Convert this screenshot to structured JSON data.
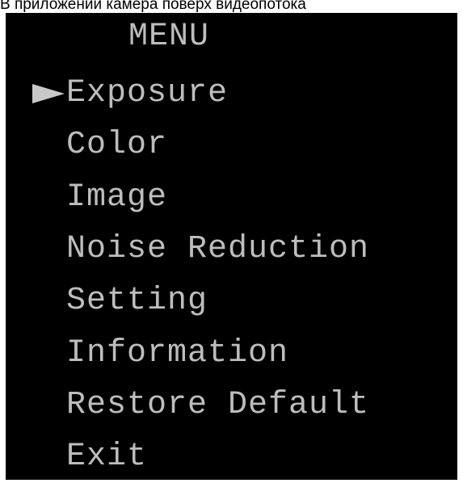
{
  "caption": "В приложении камера поверх видеопотока",
  "osd": {
    "title": "MENU",
    "selected_index": 0,
    "items": [
      {
        "label": "Exposure"
      },
      {
        "label": "Color"
      },
      {
        "label": "Image"
      },
      {
        "label": "Noise Reduction"
      },
      {
        "label": "Setting"
      },
      {
        "label": "Information"
      },
      {
        "label": "Restore Default"
      },
      {
        "label": "Exit"
      }
    ],
    "colors": {
      "background": "#000000",
      "text": "#bdbdbd",
      "cursor": "#c9c9c9"
    }
  }
}
